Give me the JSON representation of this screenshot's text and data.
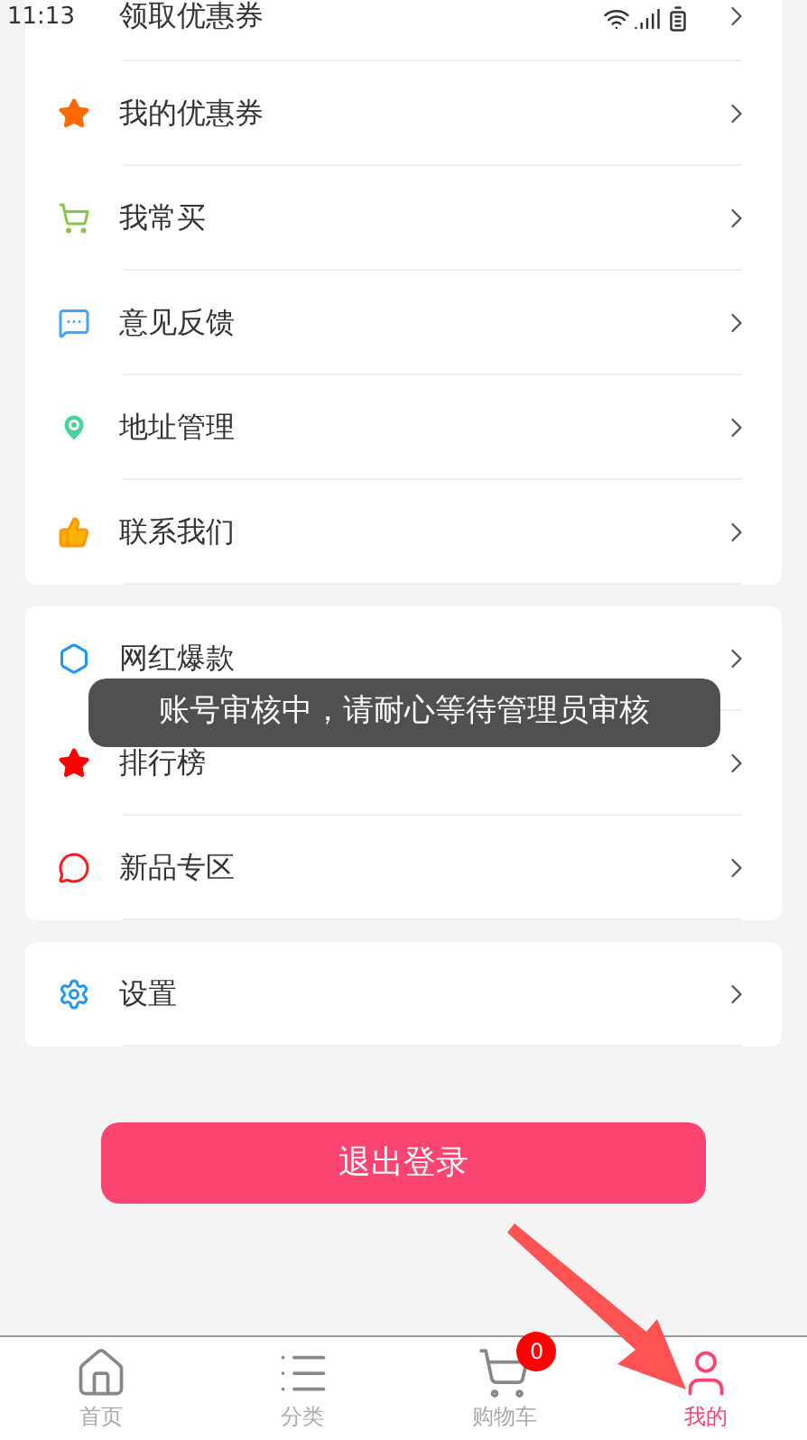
{
  "status_bar": {
    "time": "11:13"
  },
  "menu_groups": [
    {
      "items": [
        {
          "label": "领取优惠券"
        },
        {
          "label": "我的优惠券",
          "kind": "star-orange"
        },
        {
          "label": "我常买",
          "kind": "cart"
        },
        {
          "label": "意见反馈",
          "kind": "feedback"
        },
        {
          "label": "地址管理",
          "kind": "location"
        },
        {
          "label": "联系我们",
          "kind": "thumb"
        }
      ]
    },
    {
      "items": [
        {
          "label": "网红爆款",
          "kind": "hexagon"
        },
        {
          "label": "排行榜",
          "kind": "star-red"
        },
        {
          "label": "新品专区",
          "kind": "hot"
        }
      ]
    },
    {
      "items": [
        {
          "label": "设置",
          "kind": "settings"
        }
      ]
    }
  ],
  "logout_button": "退出登录",
  "toast": "账号审核中，请耐心等待管理员审核",
  "tabs": [
    {
      "label": "首页",
      "kind": "home",
      "selected": false
    },
    {
      "label": "分类",
      "kind": "category",
      "selected": false
    },
    {
      "label": "购物车",
      "kind": "cart",
      "selected": false,
      "badge": "0"
    },
    {
      "label": "我的",
      "kind": "user",
      "selected": true
    }
  ]
}
